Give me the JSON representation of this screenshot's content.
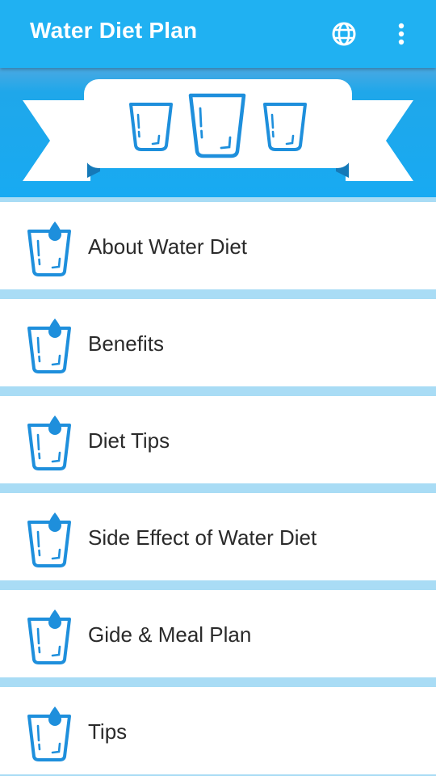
{
  "appbar": {
    "title": "Water Diet Plan",
    "icons": [
      "globe-icon",
      "more-vertical-icon"
    ]
  },
  "banner": {
    "icons": [
      "glass-icon",
      "glass-icon",
      "glass-icon",
      "ribbon-banner"
    ]
  },
  "menu": {
    "items": [
      {
        "label": "About Water Diet"
      },
      {
        "label": "Benefits"
      },
      {
        "label": "Diet Tips"
      },
      {
        "label": "Side Effect of Water Diet"
      },
      {
        "label": "Gide & Meal Plan"
      },
      {
        "label": "Tips"
      }
    ]
  },
  "colors": {
    "appbar": "#20b1f2",
    "banner": "#18aaf2",
    "divider": "#a9dcf5",
    "item_bg": "#ffffff",
    "icon_blue": "#1e8fdc",
    "text": "#2a2a2a"
  }
}
